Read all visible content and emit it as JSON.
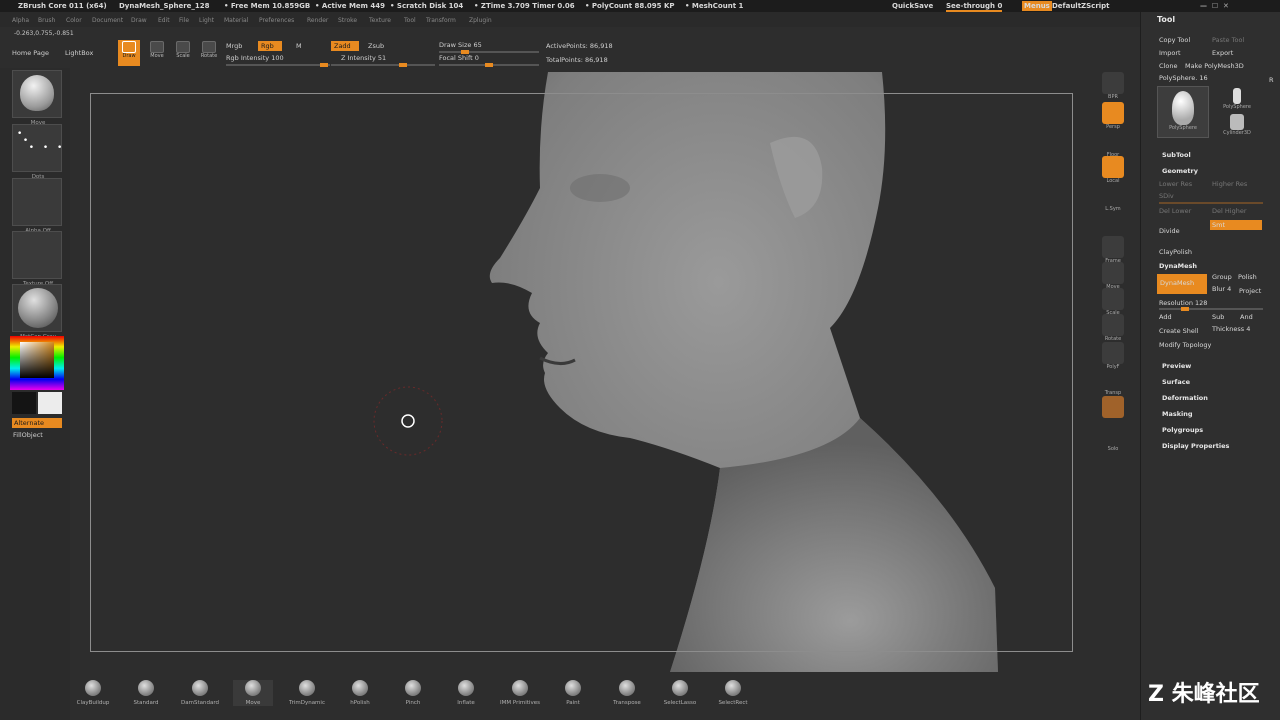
{
  "titlebar": {
    "app": "ZBrush Core 011 (x64)",
    "project": "DynaMesh_Sphere_128",
    "free_mem": "• Free Mem 10.859GB",
    "active_mem": "• Active Mem 449",
    "scratch": "• Scratch Disk 104",
    "ztime": "• ZTime 3.709  Timer 0.06",
    "polycount": "• PolyCount 88.095 KP",
    "meshcount": "• MeshCount 1",
    "quicksave": "QuickSave",
    "seethrough": "See-through  0",
    "menus": "Menus",
    "script": "DefaultZScript"
  },
  "menubar": [
    "Alpha",
    "Brush",
    "Color",
    "Document",
    "Draw",
    "Edit",
    "File",
    "Light",
    "Material",
    "Preferences",
    "Render",
    "Stroke",
    "Texture",
    "Tool",
    "Transform",
    "Zplugin"
  ],
  "coords": "-0.263,0.755,-0.851",
  "top": {
    "home": "Home Page",
    "lightbox": "LightBox",
    "draw": "Draw",
    "move": "Move",
    "scale": "Scale",
    "rotate": "Rotate",
    "mrgb": "Mrgb",
    "rgb": "Rgb",
    "m": "M",
    "rgb_intensity": "Rgb Intensity 100",
    "zadd": "Zadd",
    "zsub": "Zsub",
    "z_intensity": "Z Intensity 51",
    "draw_size": "Draw Size 65",
    "focal_shift": "Focal Shift 0",
    "active_points": "ActivePoints: 86,918",
    "total_points": "TotalPoints: 86,918"
  },
  "left": {
    "move": "Move",
    "dots": "Dots",
    "alpha": "Alpha Off",
    "texture": "Texture Off",
    "matcap": "MatCap Gray",
    "alternate": "Alternate",
    "fillobject": "FillObject"
  },
  "right_shelf": [
    "BPR",
    "Persp",
    "Floor",
    "Local",
    "L.Sym",
    "Frame",
    "Move",
    "Scale",
    "Rotate",
    "PolyF",
    "Transp",
    "Solo"
  ],
  "tool": {
    "title": "Tool",
    "copy": "Copy Tool",
    "paste": "Paste Tool",
    "import": "Import",
    "export": "Export",
    "clone": "Clone",
    "make": "Make PolyMesh3D",
    "polysphere": "PolySphere. 16",
    "r": "R",
    "thumb1": "PolySphere",
    "thumb2": "PolySphere",
    "thumb3": "Cylinder3D",
    "subtool": "SubTool",
    "geometry": "Geometry",
    "lower": "Lower Res",
    "higher": "Higher Res",
    "sdiv": "SDiv",
    "del_lower": "Del Lower",
    "del_higher": "Del Higher",
    "divide": "Divide",
    "smt": "Smt",
    "claypolish": "ClayPolish",
    "dynamesh_h": "DynaMesh",
    "dynamesh_btn": "DynaMesh",
    "group": "Group",
    "polish": "Polish",
    "blur": "Blur 4",
    "project": "Project",
    "resolution": "Resolution 128",
    "add": "Add",
    "sub": "Sub",
    "and": "And",
    "create_shell": "Create Shell",
    "thickness": "Thickness 4",
    "modify": "Modify Topology",
    "preview": "Preview",
    "surface": "Surface",
    "deformation": "Deformation",
    "masking": "Masking",
    "polygroups": "Polygroups",
    "display": "Display Properties"
  },
  "brushes": [
    "ClayBuildup",
    "Standard",
    "DamStandard",
    "Move",
    "TrimDynamic",
    "hPolish",
    "Pinch",
    "Inflate",
    "IMM Primitives",
    "Paint",
    "Transpose",
    "SelectLasso",
    "SelectRect"
  ],
  "watermark": "Z 朱峰社区"
}
